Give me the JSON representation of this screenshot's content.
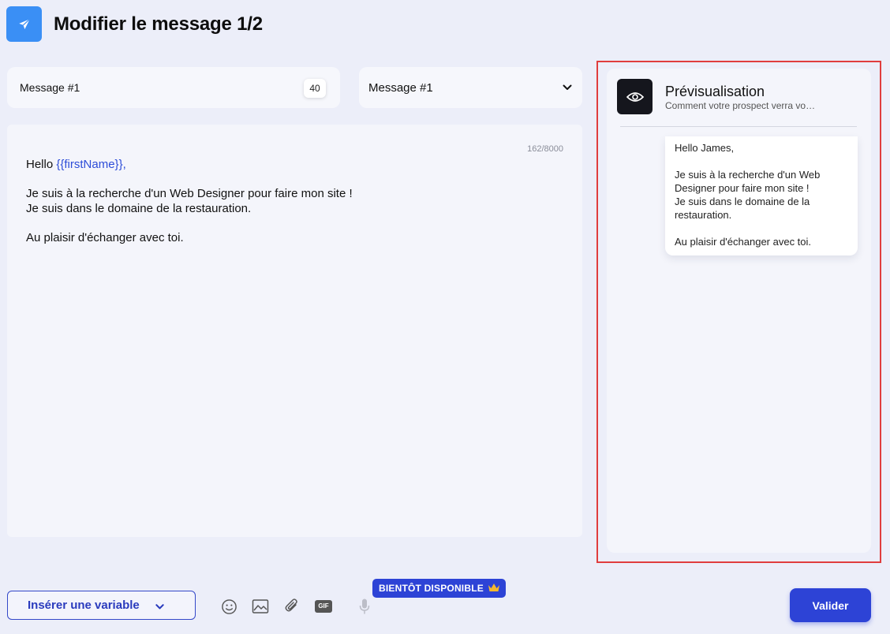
{
  "header": {
    "title": "Modifier le message 1/2",
    "icon": "send-icon"
  },
  "title_field": {
    "value": "Message #1",
    "count": "40"
  },
  "message_select": {
    "selected": "Message #1"
  },
  "editor": {
    "char_count": "162/8000",
    "greeting_prefix": "Hello ",
    "variable": "{{firstName}}",
    "greeting_suffix": ",",
    "line1": "Je suis à la recherche d'un Web Designer pour faire mon site !",
    "line2": "Je suis dans le domaine de la restauration.",
    "closing": "Au plaisir d'échanger avec toi."
  },
  "preview": {
    "title": "Prévisualisation",
    "subtitle": "Comment votre prospect verra vo…",
    "icon": "eye-icon",
    "bubble": {
      "greeting": "Hello James,",
      "line1a": "Je suis à la recherche d'un Web",
      "line1b": "Designer pour faire mon site !",
      "line2a": "Je suis dans le domaine de la",
      "line2b": "restauration.",
      "closing": "Au plaisir d'échanger avec toi."
    }
  },
  "toolbar": {
    "insert_variable_label": "Insérer une variable",
    "tools": [
      "emoji-icon",
      "image-icon",
      "attachment-icon",
      "gif-icon",
      "microphone-icon"
    ],
    "gif_label": "GIF",
    "coming_soon_label": "BIENTÔT DISPONIBLE",
    "validate_label": "Valider"
  },
  "colors": {
    "accent": "#2d43d6",
    "app_icon": "#3a8ff5",
    "variable": "#2d4dd8",
    "highlight_border": "#e03d3d",
    "crown": "#f5b82e"
  }
}
